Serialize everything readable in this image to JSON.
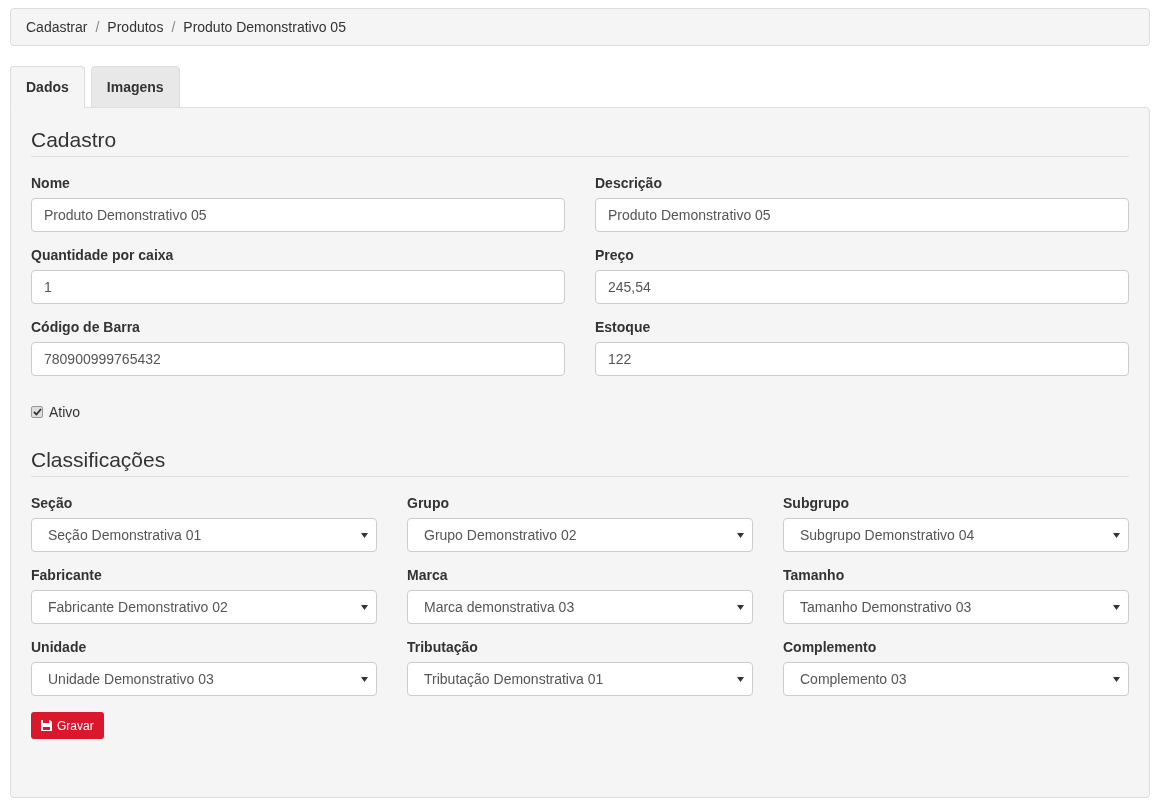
{
  "breadcrumb": [
    {
      "label": "Cadastrar"
    },
    {
      "separator": "/",
      "label": "Produtos"
    },
    {
      "separator": "/",
      "label": "Produto Demonstrativo 05"
    }
  ],
  "tabs": [
    {
      "label": "Dados",
      "selected": true
    },
    {
      "label": "Imagens",
      "selected": false
    }
  ],
  "sections": [
    {
      "title": "Cadastro",
      "kind": "pair",
      "fields": [
        {
          "kind": "input",
          "label": "Nome",
          "value": "Produto Demonstrativo 05"
        },
        {
          "kind": "input",
          "label": "Descrição",
          "value": "Produto Demonstrativo 05"
        },
        {
          "kind": "input",
          "label": "Quantidade por caixa",
          "value": "1"
        },
        {
          "kind": "input",
          "label": "Preço",
          "value": "245,54"
        },
        {
          "kind": "input",
          "label": "Código de Barra",
          "value": "780900999765432"
        },
        {
          "kind": "input",
          "label": "Estoque",
          "value": "122"
        }
      ],
      "checkbox": {
        "label": "Ativo",
        "checked": true
      }
    },
    {
      "title": "Classificações",
      "kind": "triple",
      "fields": [
        {
          "kind": "select",
          "label": "Seção",
          "value": "Seção Demonstrativa 01"
        },
        {
          "kind": "select",
          "label": "Grupo",
          "value": "Grupo Demonstrativo 02"
        },
        {
          "kind": "select",
          "label": "Subgrupo",
          "value": "Subgrupo Demonstrativo 04"
        },
        {
          "kind": "select",
          "label": "Fabricante",
          "value": "Fabricante Demonstrativo 02"
        },
        {
          "kind": "select",
          "label": "Marca",
          "value": "Marca demonstrativa 03"
        },
        {
          "kind": "select",
          "label": "Tamanho",
          "value": "Tamanho Demonstrativo 03"
        },
        {
          "kind": "select",
          "label": "Unidade",
          "value": "Unidade Demonstrativo 03"
        },
        {
          "kind": "select",
          "label": "Tributação",
          "value": "Tributação Demonstrativa 01"
        },
        {
          "kind": "select",
          "label": "Complemento",
          "value": "Complemento 03"
        }
      ]
    }
  ],
  "save_button": {
    "label": "Gravar"
  }
}
